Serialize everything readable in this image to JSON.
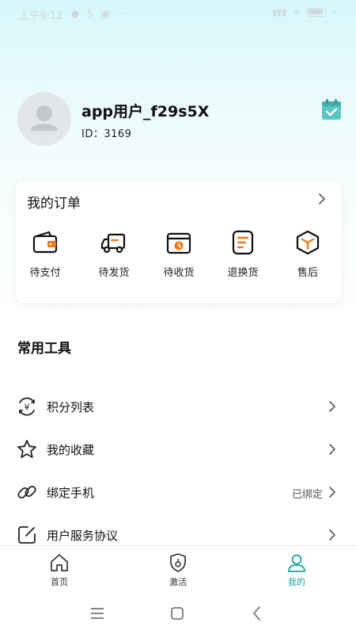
{
  "status_bar": {
    "time": "上午9:12",
    "sim": "S"
  },
  "profile": {
    "username": "app用户_f29s5X",
    "id_label": "ID：3169"
  },
  "orders": {
    "title": "我的订单",
    "items": [
      {
        "label": "待支付",
        "icon": "wallet-icon"
      },
      {
        "label": "待发货",
        "icon": "truck-icon"
      },
      {
        "label": "待收货",
        "icon": "package-clock-icon"
      },
      {
        "label": "退换货",
        "icon": "return-doc-icon"
      },
      {
        "label": "售后",
        "icon": "service-box-icon"
      }
    ]
  },
  "tools": {
    "title": "常用工具",
    "items": [
      {
        "label": "积分列表",
        "value": "",
        "icon": "points-icon"
      },
      {
        "label": "我的收藏",
        "value": "",
        "icon": "star-icon"
      },
      {
        "label": "绑定手机",
        "value": "已绑定",
        "icon": "link-icon"
      },
      {
        "label": "用户服务协议",
        "value": "",
        "icon": "edit-doc-icon"
      }
    ]
  },
  "tabbar": {
    "items": [
      {
        "label": "首页",
        "icon": "home-icon",
        "active": false
      },
      {
        "label": "激活",
        "icon": "shield-icon",
        "active": false
      },
      {
        "label": "我的",
        "icon": "user-icon",
        "active": true
      }
    ]
  },
  "colors": {
    "accent": "#1aa3a3",
    "icon_orange": "#f07a1a",
    "background_top": "#d6f7fb"
  }
}
